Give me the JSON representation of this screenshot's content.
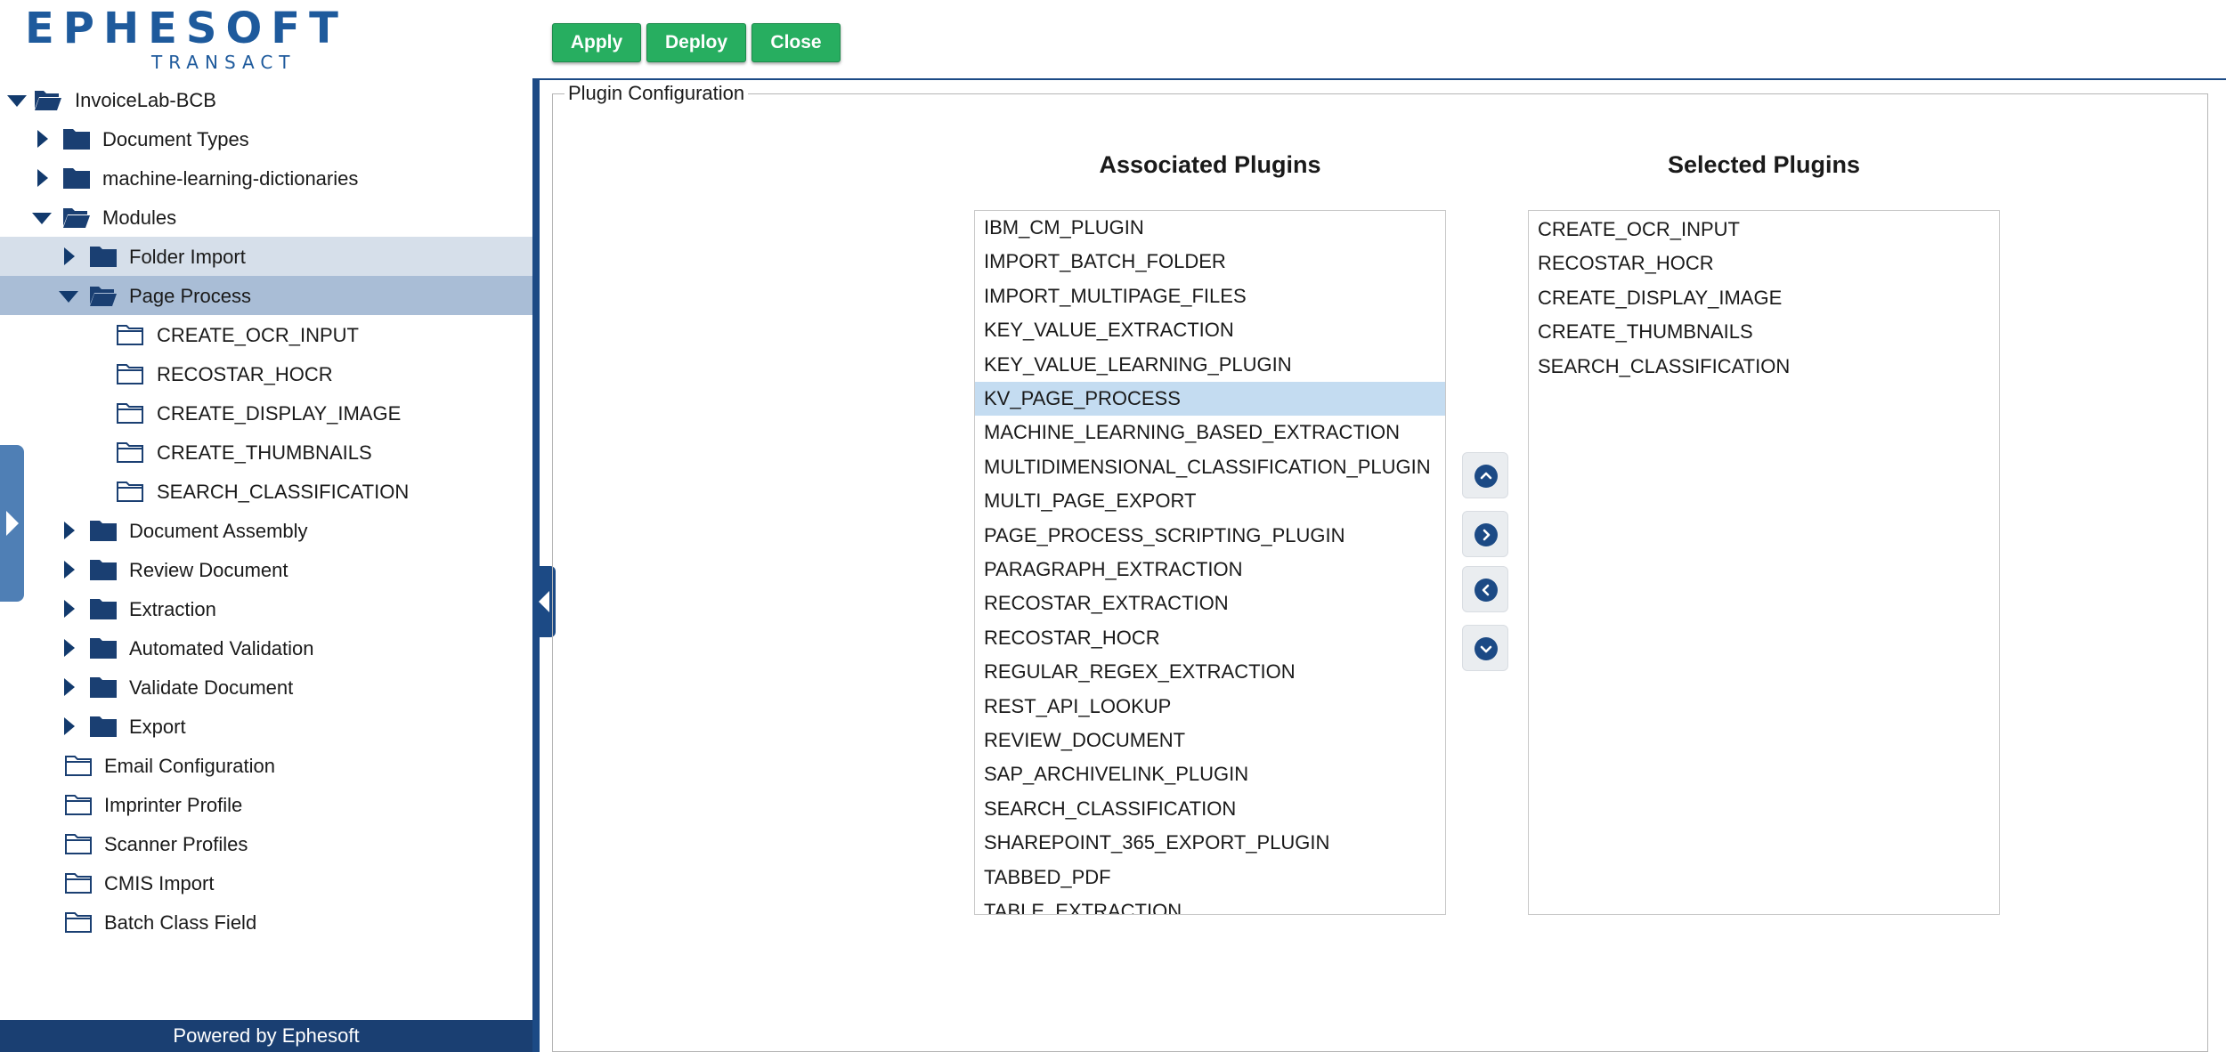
{
  "logo": {
    "word": "EPHESOFT",
    "sub": "TRANSACT"
  },
  "toolbar": {
    "apply": "Apply",
    "deploy": "Deploy",
    "close": "Close"
  },
  "tree": {
    "root": "InvoiceLab-BCB",
    "document_types": "Document Types",
    "ml_dictionaries": "machine-learning-dictionaries",
    "modules": "Modules",
    "folder_import": "Folder Import",
    "page_process": "Page Process",
    "page_process_children": [
      "CREATE_OCR_INPUT",
      "RECOSTAR_HOCR",
      "CREATE_DISPLAY_IMAGE",
      "CREATE_THUMBNAILS",
      "SEARCH_CLASSIFICATION"
    ],
    "document_assembly": "Document Assembly",
    "review_document": "Review Document",
    "extraction": "Extraction",
    "automated_validation": "Automated Validation",
    "validate_document": "Validate Document",
    "export": "Export",
    "email_configuration": "Email Configuration",
    "imprinter_profile": "Imprinter Profile",
    "scanner_profiles": "Scanner Profiles",
    "cmis_import": "CMIS Import",
    "batch_class_field": "Batch Class Field"
  },
  "footer": "Powered by Ephesoft",
  "plugin_config": {
    "legend": "Plugin Configuration",
    "associated_title": "Associated Plugins",
    "selected_title": "Selected Plugins",
    "associated": [
      "IBM_CM_PLUGIN",
      "IMPORT_BATCH_FOLDER",
      "IMPORT_MULTIPAGE_FILES",
      "KEY_VALUE_EXTRACTION",
      "KEY_VALUE_LEARNING_PLUGIN",
      "KV_PAGE_PROCESS",
      "MACHINE_LEARNING_BASED_EXTRACTION",
      "MULTIDIMENSIONAL_CLASSIFICATION_PLUGIN",
      "MULTI_PAGE_EXPORT",
      "PAGE_PROCESS_SCRIPTING_PLUGIN",
      "PARAGRAPH_EXTRACTION",
      "RECOSTAR_EXTRACTION",
      "RECOSTAR_HOCR",
      "REGULAR_REGEX_EXTRACTION",
      "REST_API_LOOKUP",
      "REVIEW_DOCUMENT",
      "SAP_ARCHIVELINK_PLUGIN",
      "SEARCH_CLASSIFICATION",
      "SHAREPOINT_365_EXPORT_PLUGIN",
      "TABBED_PDF",
      "TABLE_EXTRACTION"
    ],
    "associated_selected": "KV_PAGE_PROCESS",
    "selected": [
      "CREATE_OCR_INPUT",
      "RECOSTAR_HOCR",
      "CREATE_DISPLAY_IMAGE",
      "CREATE_THUMBNAILS",
      "SEARCH_CLASSIFICATION"
    ]
  },
  "icons": {
    "move_up": "chevron-up-icon",
    "move_right": "chevron-right-icon",
    "move_left": "chevron-left-icon",
    "move_down": "chevron-down-icon"
  },
  "colors": {
    "brand_blue": "#1e5a9c",
    "nav_dark": "#1a3f72",
    "button_green": "#27ae60",
    "selection_light": "#d6dfea",
    "selection_dark": "#a9bdd6",
    "list_selection": "#c4dcf1"
  }
}
